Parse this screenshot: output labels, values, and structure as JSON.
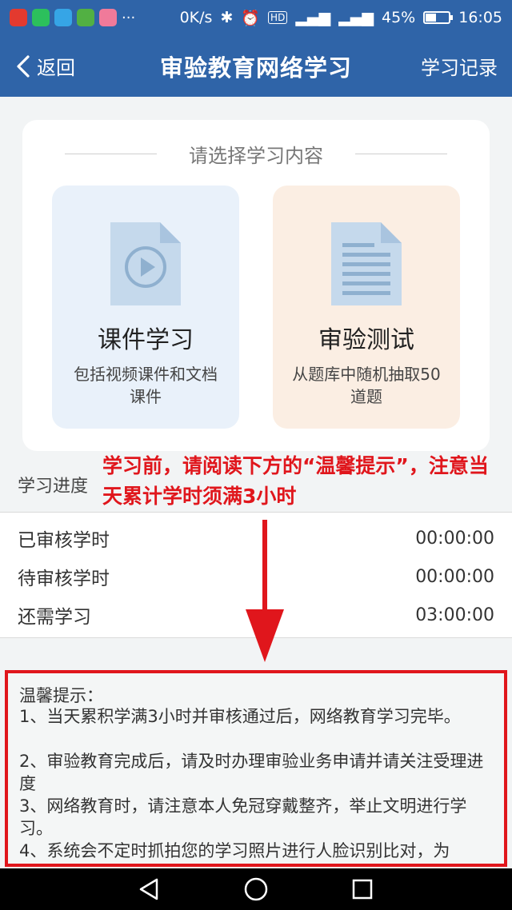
{
  "status_bar": {
    "speed": "0K/s",
    "battery": "45%",
    "battery_level": 0.45,
    "time": "16:05"
  },
  "nav": {
    "back_label": "返回",
    "title": "审验教育网络学习",
    "record_label": "学习记录"
  },
  "content": {
    "section_title": "请选择学习内容",
    "options": [
      {
        "title": "课件学习",
        "desc": "包括视频课件和文档课件"
      },
      {
        "title": "审验测试",
        "desc": "从题库中随机抽取50道题"
      }
    ]
  },
  "progress": {
    "label": "学习进度",
    "annotation": "学习前，请阅读下方的“温馨提示”，注意当天累计学时须满3小时",
    "rows": [
      {
        "label": "已审核学时",
        "value": "00:00:00"
      },
      {
        "label": "待审核学时",
        "value": "00:00:00"
      },
      {
        "label": "还需学习",
        "value": "03:00:00"
      }
    ]
  },
  "tips": {
    "title": "温馨提示：",
    "items": [
      "1、当天累积学满3小时并审核通过后，网络教育学习完毕。",
      "2、审验教育完成后，请及时办理审验业务申请并请关注受理进度",
      "3、网络教育时，请注意本人免冠穿戴整齐，举止文明进行学习。",
      "4、系统会不定时抓拍您的学习照片进行人脸识别比对，为"
    ]
  },
  "colors": {
    "primary": "#2f64a8",
    "annotation_red": "#e0161c",
    "course_tile": "#e9f1fa",
    "test_tile": "#fbeee3"
  },
  "icons": {
    "back": "chevron-left-icon",
    "course": "video-document-icon",
    "test": "text-document-icon",
    "sys_back": "triangle-back-icon",
    "sys_home": "circle-home-icon",
    "sys_recent": "square-recent-icon"
  }
}
